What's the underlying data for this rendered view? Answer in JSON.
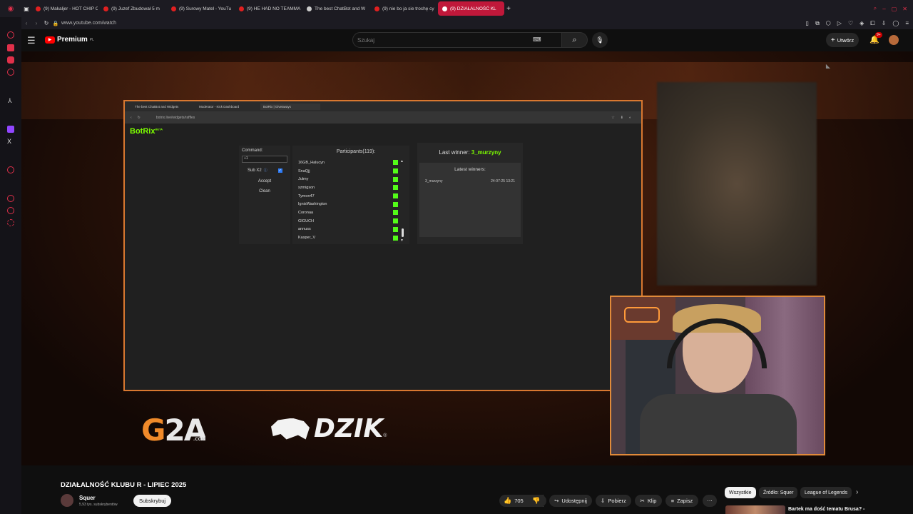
{
  "tabs": [
    {
      "label": "(9) Makaljer - HOT CHIP C",
      "color": "#e02020"
    },
    {
      "label": "(9) Juzef Zbudował 5 m",
      "color": "#e02020"
    },
    {
      "label": "(9) Surowy Matel - YouTu",
      "color": "#e02020"
    },
    {
      "label": "(9) HE HAD NO TEAMMA",
      "color": "#e02020"
    },
    {
      "label": "The best ChatBot and W",
      "color": "#cccccc"
    },
    {
      "label": "(9) nie bo ja sie trochę cy",
      "color": "#e02020"
    },
    {
      "label": "(9) DZIAŁALNOŚĆ KL",
      "color": "#ffffff"
    }
  ],
  "address": "www.youtube.com/watch",
  "header": {
    "logo_text": "Premium",
    "region": "PL",
    "search_placeholder": "Szukaj",
    "create_label": "Utwórz",
    "notif_count": "9+"
  },
  "stream": {
    "tabs": [
      "The best ChatBot and Widgets",
      "Moderator - Kick Dashboard",
      "BotRix | Giveaways"
    ],
    "url": "botrix.live/widgets/raffles",
    "brand": "BotRix",
    "brand_badge": "BETA",
    "command_label": "Command:",
    "command_value": "+1",
    "sub_label": "Sub X2",
    "accept": "Accept",
    "clean": "Clean",
    "participants_title": "Participants(119):",
    "participants": [
      "16GB_Halucyn",
      "SnaQjj",
      "Julmy",
      "szmigson",
      "Tymon47",
      "IgnisWashington",
      "Coronaa",
      "GIGUCH",
      "annuss",
      "Kasper_V"
    ],
    "last_winner_label": "Last winner:",
    "last_winner_name": "3_murzyny",
    "latest_winners_title": "Latest winners:",
    "winner_row": {
      "name": "3_murzyny",
      "date": "24-07-25 13:21"
    },
    "sponsor1": "G2A",
    "sponsor1_sub": ".COM",
    "sponsor2": "DZIK",
    "sponsor2_mark": "®"
  },
  "video": {
    "title": "DZIAŁALNOŚĆ KLUBU R - LIPIEC 2025",
    "channel": "Squer",
    "subs": "5,93 tys. subskrybentów",
    "subscribe": "Subskrybuj",
    "likes": "705",
    "share": "Udostępnij",
    "download": "Pobierz",
    "clip": "Klip",
    "save": "Zapisz",
    "more": "⋯"
  },
  "chips": [
    "Wszystkie",
    "Źródło: Squer",
    "League of Legends"
  ],
  "next_video": "Bartek ma dość tematu Brusa? -"
}
